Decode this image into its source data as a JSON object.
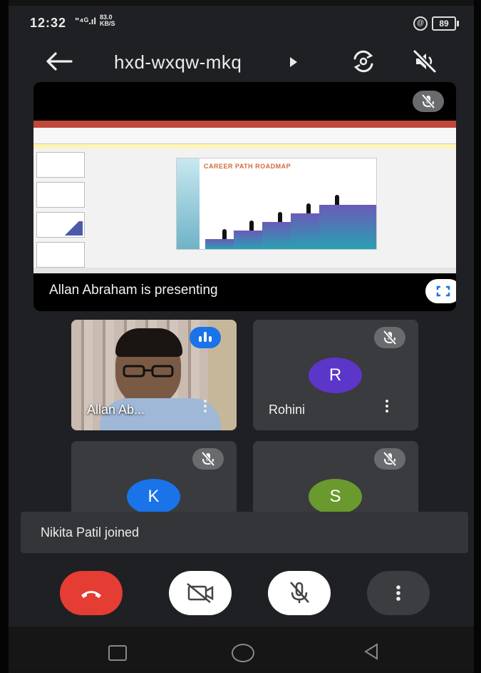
{
  "status_bar": {
    "time": "12:32",
    "signal": "\"⁴ᴳ.ıl",
    "speed_value": "83.0",
    "speed_unit": "KB/S",
    "vpn": "@",
    "battery": "89"
  },
  "header": {
    "title": "hxd-wxqw-mkq"
  },
  "presentation": {
    "presenter_text": "Allan Abraham is presenting",
    "slide_title": "CAREER PATH ROADMAP"
  },
  "participants": [
    {
      "name": "Allan Ab...",
      "speaking": true
    },
    {
      "name": "Rohini",
      "initial": "R",
      "color": "#5c35c9"
    },
    {
      "initial": "K",
      "color": "#1a73e8"
    },
    {
      "initial": "S",
      "color": "#6a9a2e"
    }
  ],
  "toast": {
    "text": "Nikita Patil joined"
  },
  "colors": {
    "end_call": "#e53c33",
    "speaking": "#1a73e8",
    "background": "#1f2023"
  }
}
